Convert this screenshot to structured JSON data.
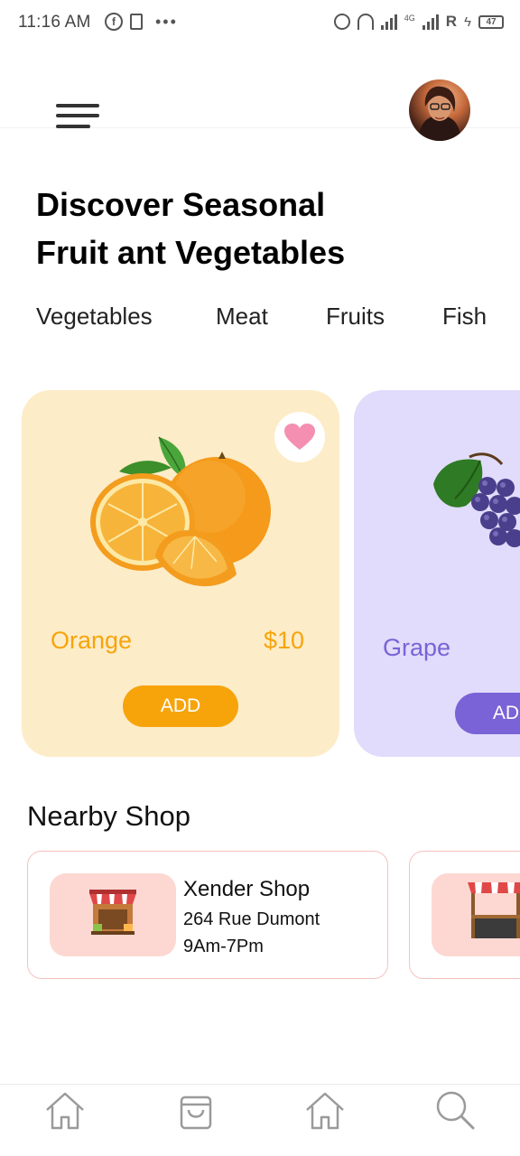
{
  "status_bar": {
    "time": "11:16 AM",
    "facebook_glyph": "f",
    "roaming_label": "R",
    "network_label": "4G",
    "battery_level": "47"
  },
  "header": {
    "menu_icon": "hamburger-menu-icon",
    "avatar": "user-avatar"
  },
  "page_title_line1": "Discover Seasonal",
  "page_title_line2": "Fruit ant Vegetables",
  "categories": [
    {
      "label": "Vegetables"
    },
    {
      "label": "Meat"
    },
    {
      "label": "Fruits"
    },
    {
      "label": "Fish"
    }
  ],
  "products": [
    {
      "name": "Orange",
      "price": "$10",
      "button": "ADD",
      "favorite": true,
      "card_color": "#fdecc8",
      "accent": "#f7a40b"
    },
    {
      "name": "Grape",
      "button": "ADD",
      "card_color": "#e1dcfb",
      "accent": "#7a63d6"
    }
  ],
  "nearby": {
    "title": "Nearby Shop",
    "shops": [
      {
        "name": "Xender Shop",
        "address": "264 Rue Dumont",
        "hours": "9Am-7Pm"
      }
    ]
  },
  "bottom_nav": [
    {
      "icon": "home-icon"
    },
    {
      "icon": "shopping-bag-icon"
    },
    {
      "icon": "home-icon"
    },
    {
      "icon": "search-icon"
    }
  ],
  "colors": {
    "orange_text": "#f7a40b",
    "grape_text": "#7a63d6",
    "heart": "#f48fb1",
    "shop_border": "#f7c2be",
    "shop_thumb": "#fdd8d2"
  }
}
